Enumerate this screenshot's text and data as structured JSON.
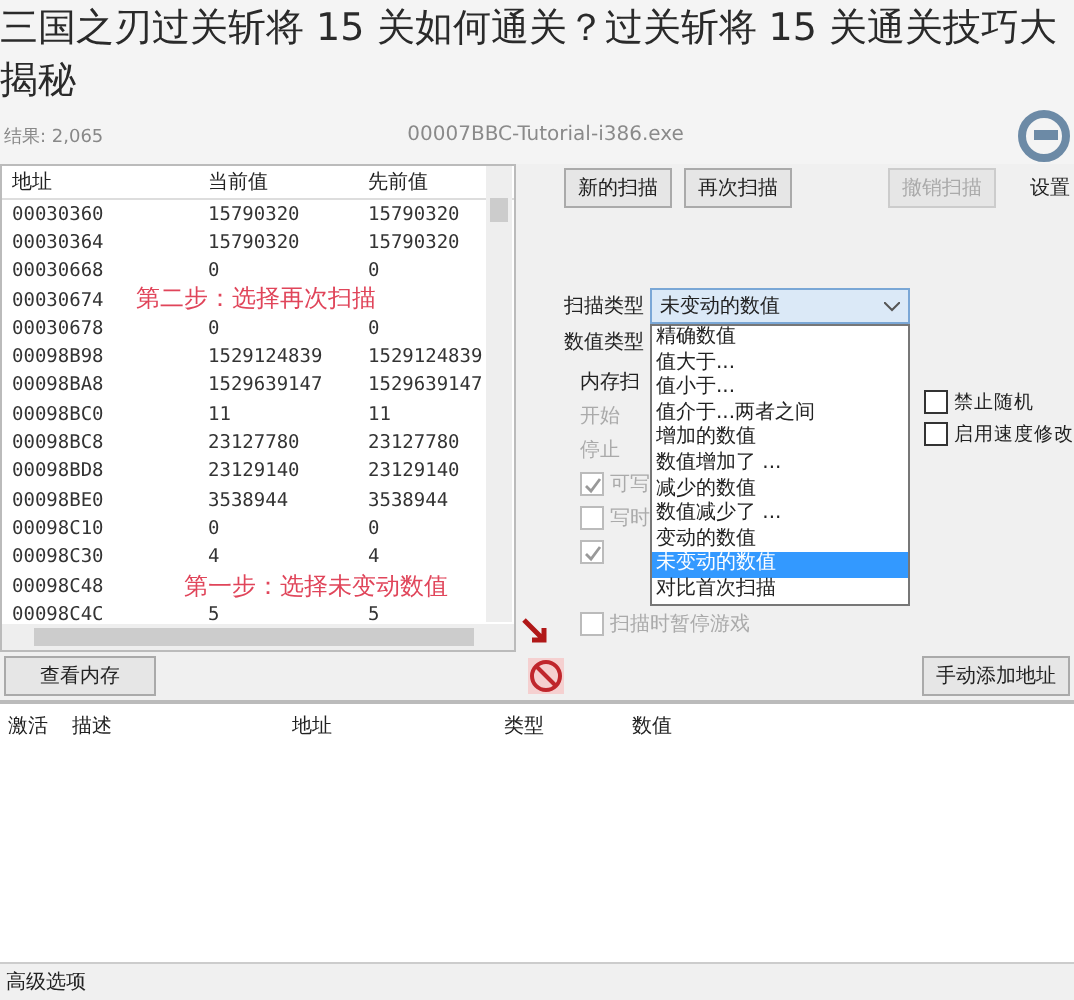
{
  "headline": "三国之刃过关斩将 15 关如何通关？过关斩将 15 关通关技巧大揭秘",
  "process": "00007BBC-Tutorial-i386.exe",
  "results": "结果: 2,065",
  "settings_label": "设置",
  "table": {
    "columns": [
      "地址",
      "当前值",
      "先前值"
    ],
    "rows": [
      {
        "address": "00030360",
        "current": "15790320",
        "previous": "15790320"
      },
      {
        "address": "00030364",
        "current": "15790320",
        "previous": "15790320"
      },
      {
        "address": "00030668",
        "current": "0",
        "previous": "0"
      },
      {
        "address": "00030674"
      },
      {
        "address": "00030678",
        "current": "0",
        "previous": "0"
      },
      {
        "address": "00098B98",
        "current": "1529124839",
        "previous": "1529124839"
      },
      {
        "address": "00098BA8",
        "current": "1529639147",
        "previous": "1529639147"
      },
      {
        "address": "00098BC0",
        "current": "11",
        "previous": "11"
      },
      {
        "address": "00098BC8",
        "current": "23127780",
        "previous": "23127780"
      },
      {
        "address": "00098BD8",
        "current": "23129140",
        "previous": "23129140"
      },
      {
        "address": "00098BE0",
        "current": "3538944",
        "previous": "3538944"
      },
      {
        "address": "00098C10",
        "current": "0",
        "previous": "0"
      },
      {
        "address": "00098C30",
        "current": "4",
        "previous": "4"
      },
      {
        "address": "00098C48"
      },
      {
        "address": "00098C4C",
        "current": "5",
        "previous": "5"
      }
    ]
  },
  "scan_buttons": [
    {
      "label": "新的扫描",
      "disabled": false
    },
    {
      "label": "再次扫描",
      "disabled": false
    },
    {
      "label": "撤销扫描",
      "disabled": true
    }
  ],
  "scan_type": {
    "label": "扫描类型",
    "value": "未变动的数值",
    "options": [
      {
        "label": "精确数值",
        "selected": false
      },
      {
        "label": "值大于...",
        "selected": false
      },
      {
        "label": "值小于...",
        "selected": false
      },
      {
        "label": "值介于...两者之间",
        "selected": false
      },
      {
        "label": "增加的数值",
        "selected": false
      },
      {
        "label": "数值增加了 ...",
        "selected": false
      },
      {
        "label": "减少的数值",
        "selected": false
      },
      {
        "label": "数值减少了 ...",
        "selected": false
      },
      {
        "label": "变动的数值",
        "selected": false
      },
      {
        "label": "未变动的数值",
        "selected": true
      },
      {
        "label": "对比首次扫描",
        "selected": false
      }
    ]
  },
  "value_type": {
    "label": "数值类型"
  },
  "memory_options": {
    "title": "内存扫",
    "start_label": "开始",
    "stop_label": "停止",
    "checkboxes": [
      {
        "label": "可写",
        "checked": true
      },
      {
        "label": "写时",
        "checked": false
      },
      {
        "checked": true
      },
      {
        "label": "扫描时暂停游戏",
        "checked": false
      }
    ]
  },
  "right_checkboxes": [
    {
      "label": "禁止随机",
      "checked": false
    },
    {
      "label": "启用速度修改",
      "checked": false
    }
  ],
  "view_memory_button": "查看内存",
  "add_address_button": "手动添加地址",
  "address_list": {
    "columns": [
      "激活",
      "描述",
      "地址",
      "类型",
      "数值"
    ]
  },
  "status_bar": "高级选项",
  "annotations": [
    {
      "text": "第二步：选择再次扫描"
    },
    {
      "text": "第一步：选择未变动数值"
    }
  ]
}
